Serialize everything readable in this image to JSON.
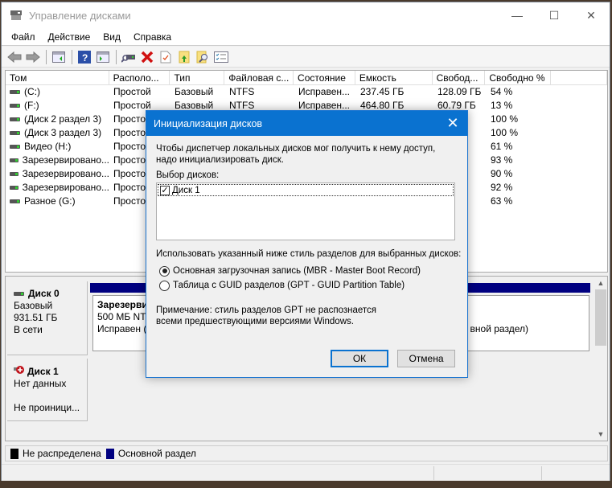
{
  "window": {
    "title": "Управление дисками",
    "controls": {
      "minimize": "—",
      "maximize": "☐",
      "close": "✕"
    }
  },
  "menu": [
    "Файл",
    "Действие",
    "Вид",
    "Справка"
  ],
  "toolbar": {
    "icons": [
      "back-icon",
      "forward-icon",
      "console-tree-icon",
      "help-icon",
      "action-pane-icon",
      "connect-icon",
      "delete-icon",
      "properties-icon",
      "import-icon",
      "search-icon",
      "checklist-icon"
    ]
  },
  "volume_list": {
    "columns": [
      "Том",
      "Располо...",
      "Тип",
      "Файловая с...",
      "Состояние",
      "Емкость",
      "Свобод...",
      "Свободно %"
    ],
    "rows": [
      {
        "volume": "(C:)",
        "layout": "Простой",
        "type": "Базовый",
        "fs": "NTFS",
        "status": "Исправен...",
        "capacity": "237.45 ГБ",
        "free": "128.09 ГБ",
        "free_pct": "54 %"
      },
      {
        "volume": "(F:)",
        "layout": "Простой",
        "type": "Базовый",
        "fs": "NTFS",
        "status": "Исправен...",
        "capacity": "464.80 ГБ",
        "free": "60.79 ГБ",
        "free_pct": "13 %"
      },
      {
        "volume": "(Диск 2 раздел 3)",
        "layout": "Простой",
        "type": "",
        "fs": "",
        "status": "",
        "capacity": "",
        "free": "",
        "free_pct": "100 %"
      },
      {
        "volume": "(Диск 3 раздел 3)",
        "layout": "Простой",
        "type": "",
        "fs": "",
        "status": "",
        "capacity": "",
        "free": "",
        "free_pct": "100 %"
      },
      {
        "volume": "Видео (H:)",
        "layout": "Простой",
        "type": "",
        "fs": "",
        "status": "",
        "capacity": "",
        "free": "ГБ",
        "free_pct": "61 %"
      },
      {
        "volume": "Зарезервировано...",
        "layout": "Простой",
        "type": "",
        "fs": "",
        "status": "",
        "capacity": "",
        "free": "",
        "free_pct": "93 %"
      },
      {
        "volume": "Зарезервировано...",
        "layout": "Простой",
        "type": "",
        "fs": "",
        "status": "",
        "capacity": "",
        "free": "",
        "free_pct": "90 %"
      },
      {
        "volume": "Зарезервировано...",
        "layout": "Простой",
        "type": "",
        "fs": "",
        "status": "",
        "capacity": "",
        "free": "",
        "free_pct": "92 %"
      },
      {
        "volume": "Разное (G:)",
        "layout": "Простой",
        "type": "",
        "fs": "",
        "status": "",
        "capacity": "",
        "free": "ГБ",
        "free_pct": "63 %"
      }
    ]
  },
  "graphical_view": {
    "disks": [
      {
        "name": "Диск 0",
        "type": "Базовый",
        "size": "931.51 ГБ",
        "state": "В сети",
        "partition": {
          "name": "Зарезерви",
          "detail": "500 МБ NTF",
          "status": "Исправен (",
          "status_tail": "вной раздел)"
        }
      },
      {
        "name": "Диск 1",
        "type": "Нет данных",
        "state": "Не проиници..."
      }
    ]
  },
  "legend": [
    {
      "label": "Не распределена",
      "color": "#000000"
    },
    {
      "label": "Основной раздел",
      "color": "#000080"
    }
  ],
  "dialog": {
    "title": "Инициализация дисков",
    "intro": "Чтобы диспетчер локальных дисков мог получить к нему доступ, надо инициализировать диск.",
    "select_label": "Выбор дисков:",
    "disks": [
      {
        "label": "Диск 1",
        "checked": true
      }
    ],
    "style_label": "Использовать указанный ниже стиль разделов для выбранных дисков:",
    "options": [
      {
        "label": "Основная загрузочная запись (MBR - Master Boot Record)",
        "selected": true
      },
      {
        "label": "Таблица с GUID разделов (GPT - GUID Partition Table)",
        "selected": false
      }
    ],
    "note": "Примечание: стиль разделов GPT не распознается всеми предшествующими версиями Windows.",
    "ok_label": "ОК",
    "cancel_label": "Отмена"
  }
}
